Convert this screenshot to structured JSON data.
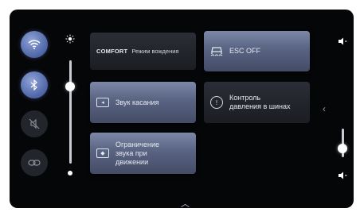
{
  "quick_toggles": [
    {
      "icon": "wifi-icon",
      "state": "on"
    },
    {
      "icon": "bluetooth-icon",
      "state": "on"
    },
    {
      "icon": "mute-icon",
      "state": "off"
    },
    {
      "icon": "link-icon",
      "state": "off"
    }
  ],
  "brightness_slider": {
    "icon_top": "sun-icon",
    "icon_bottom": "sun-small-icon",
    "level_percent": 75
  },
  "tiles": {
    "comfort": {
      "mode": "COMFORT",
      "label": "Режим вождения"
    },
    "esc": {
      "label": "ESC OFF"
    },
    "touch_sound": {
      "label": "Звук касания"
    },
    "tire_pressure": {
      "label": "Контроль давления в шинах"
    },
    "speed_limit": {
      "label": "Ограничение звука при движении"
    }
  },
  "volume_slider": {
    "icon_top": "volume-icon",
    "icon_bottom": "volume-low-icon",
    "level_percent": 30
  },
  "side_chevron": "‹",
  "bottom_handle": "︿",
  "colors": {
    "accent": "#5c6685",
    "toggle_active": "#4d64a6",
    "background": "#050608"
  }
}
